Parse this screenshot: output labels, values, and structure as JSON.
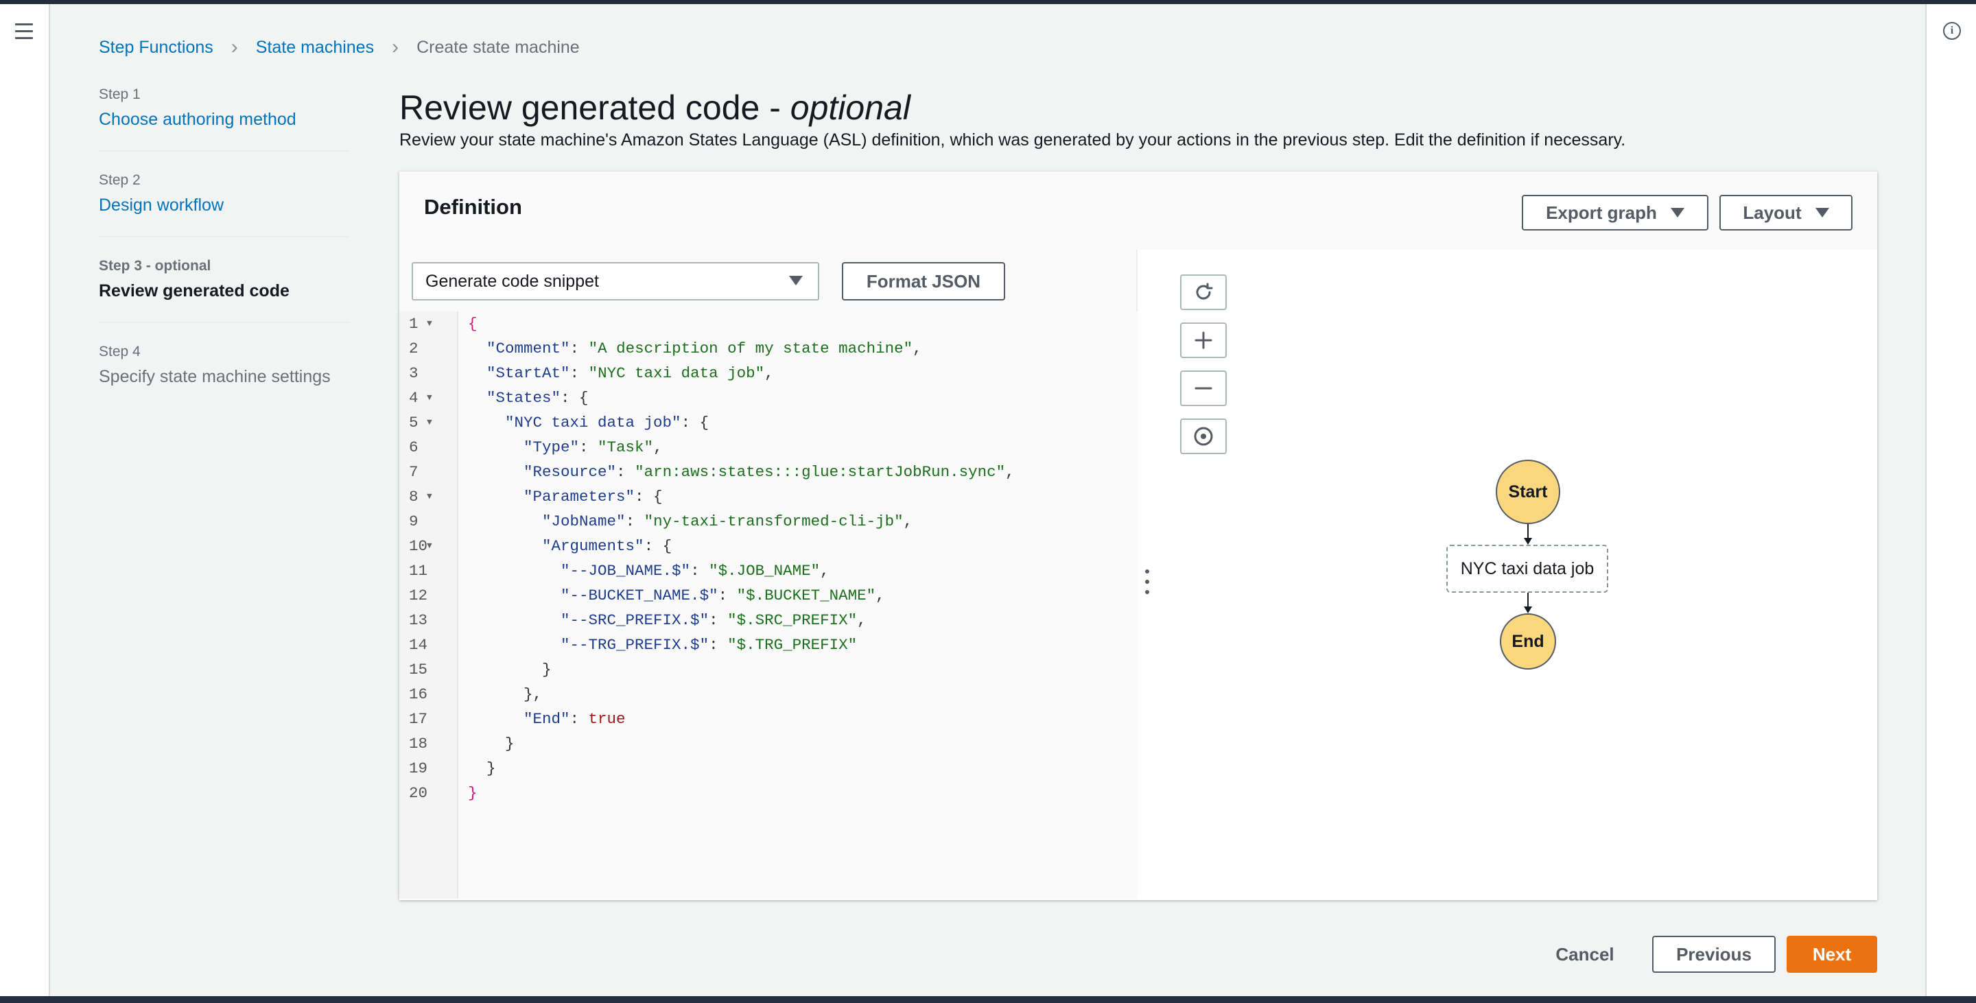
{
  "breadcrumb": [
    {
      "label": "Step Functions"
    },
    {
      "label": "State machines"
    },
    {
      "label": "Create state machine"
    }
  ],
  "steps": [
    {
      "number": "Step 1",
      "title": "Choose authoring method"
    },
    {
      "number": "Step 2",
      "title": "Design workflow"
    },
    {
      "number": "Step 3 - optional",
      "title": "Review generated code"
    },
    {
      "number": "Step 4",
      "title": "Specify state machine settings"
    }
  ],
  "page": {
    "title": "Review generated code - ",
    "title_italic": "optional",
    "description": "Review your state machine's Amazon States Language (ASL) definition, which was generated by your actions in the previous step. Edit the definition if necessary."
  },
  "definition": {
    "title": "Definition",
    "export_label": "Export graph",
    "layout_label": "Layout",
    "snippet_select": "Generate code snippet",
    "format_label": "Format JSON"
  },
  "code": {
    "line_numbers": [
      "1",
      "2",
      "3",
      "4",
      "5",
      "6",
      "7",
      "8",
      "9",
      "10",
      "11",
      "12",
      "13",
      "14",
      "15",
      "16",
      "17",
      "18",
      "19",
      "20"
    ],
    "comment_key": "\"Comment\"",
    "comment_val": "\"A description of my state machine\"",
    "startat_key": "\"StartAt\"",
    "startat_val": "\"NYC taxi data job\"",
    "states_key": "\"States\"",
    "state_key": "\"NYC taxi data job\"",
    "type_key": "\"Type\"",
    "type_val": "\"Task\"",
    "resource_key": "\"Resource\"",
    "resource_val": "\"arn:aws:states:::glue:startJobRun.sync\"",
    "params_key": "\"Parameters\"",
    "jobname_key": "\"JobName\"",
    "jobname_val": "\"ny-taxi-transformed-cli-jb\"",
    "args_key": "\"Arguments\"",
    "arg1_key": "\"--JOB_NAME.$\"",
    "arg1_val": "\"$.JOB_NAME\"",
    "arg2_key": "\"--BUCKET_NAME.$\"",
    "arg2_val": "\"$.BUCKET_NAME\"",
    "arg3_key": "\"--SRC_PREFIX.$\"",
    "arg3_val": "\"$.SRC_PREFIX\"",
    "arg4_key": "\"--TRG_PREFIX.$\"",
    "arg4_val": "\"$.TRG_PREFIX\"",
    "end_key": "\"End\"",
    "end_val": "true"
  },
  "graph": {
    "start_label": "Start",
    "task_label": "NYC taxi data job",
    "end_label": "End"
  },
  "footer": {
    "cancel_label": "Cancel",
    "previous_label": "Previous",
    "next_label": "Next"
  },
  "colors": {
    "link": "#0073bb",
    "primary": "#ec7211",
    "node_fill": "#f9d77e",
    "header_dark": "#232f3e"
  }
}
